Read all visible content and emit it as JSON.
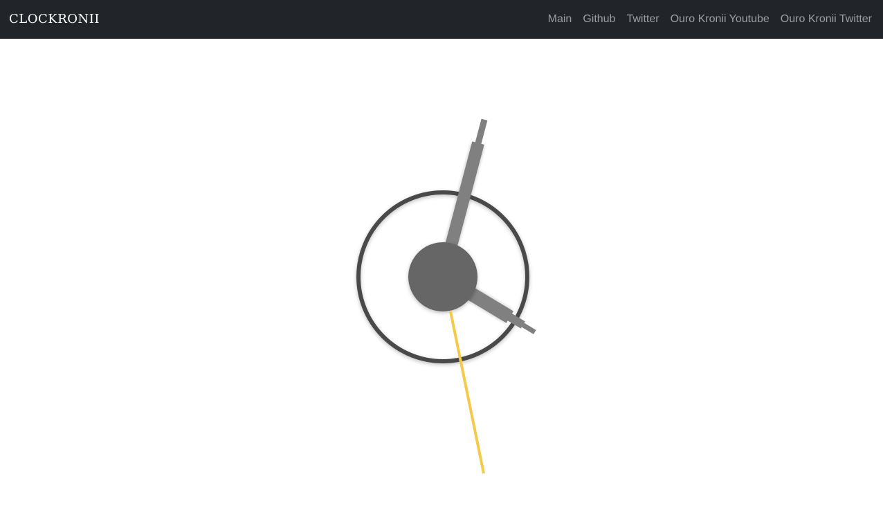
{
  "navbar": {
    "brand": "CLOCKRONII",
    "links": [
      {
        "label": "Main"
      },
      {
        "label": "Github"
      },
      {
        "label": "Twitter"
      },
      {
        "label": "Ouro Kronii Youtube"
      },
      {
        "label": "Ouro Kronii Twitter"
      }
    ]
  },
  "clock": {
    "face_color": "#4a4a4a",
    "hub_color": "#666666",
    "hand_color": "#808080",
    "second_hand_color": "#f6c94a"
  }
}
